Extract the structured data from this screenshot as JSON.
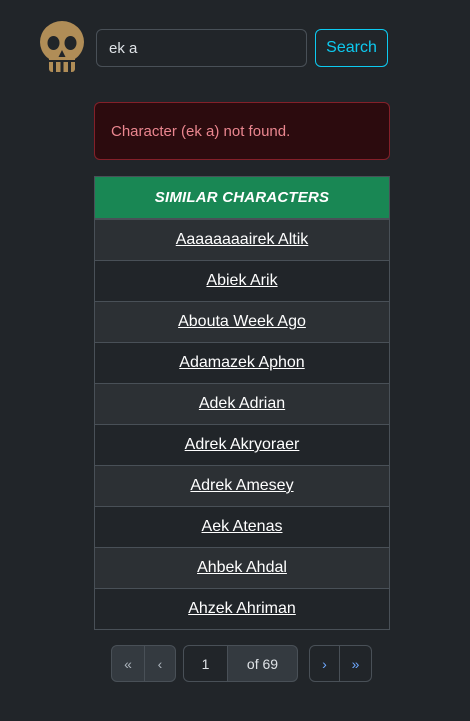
{
  "search": {
    "value": "ek a",
    "button_label": "Search"
  },
  "alert": {
    "message": "Character (ek a) not found."
  },
  "similar": {
    "heading": "SIMILAR CHARACTERS",
    "items": [
      "Aaaaaaaairek Altik",
      "Abiek Arik",
      "Abouta Week Ago",
      "Adamazek Aphon",
      "Adek Adrian",
      "Adrek Akryoraer",
      "Adrek Amesey",
      "Aek Atenas",
      "Ahbek Ahdal",
      "Ahzek Ahriman"
    ]
  },
  "pagination": {
    "first": "«",
    "prev": "‹",
    "page": "1",
    "of_total": "of 69",
    "next": "›",
    "last": "»"
  },
  "colors": {
    "background": "#212529",
    "header_green": "#198754",
    "search_cyan": "#0dcaf0",
    "alert_bg": "#2c0b0e",
    "alert_text": "#ea868f",
    "skull": "#b08d57"
  }
}
